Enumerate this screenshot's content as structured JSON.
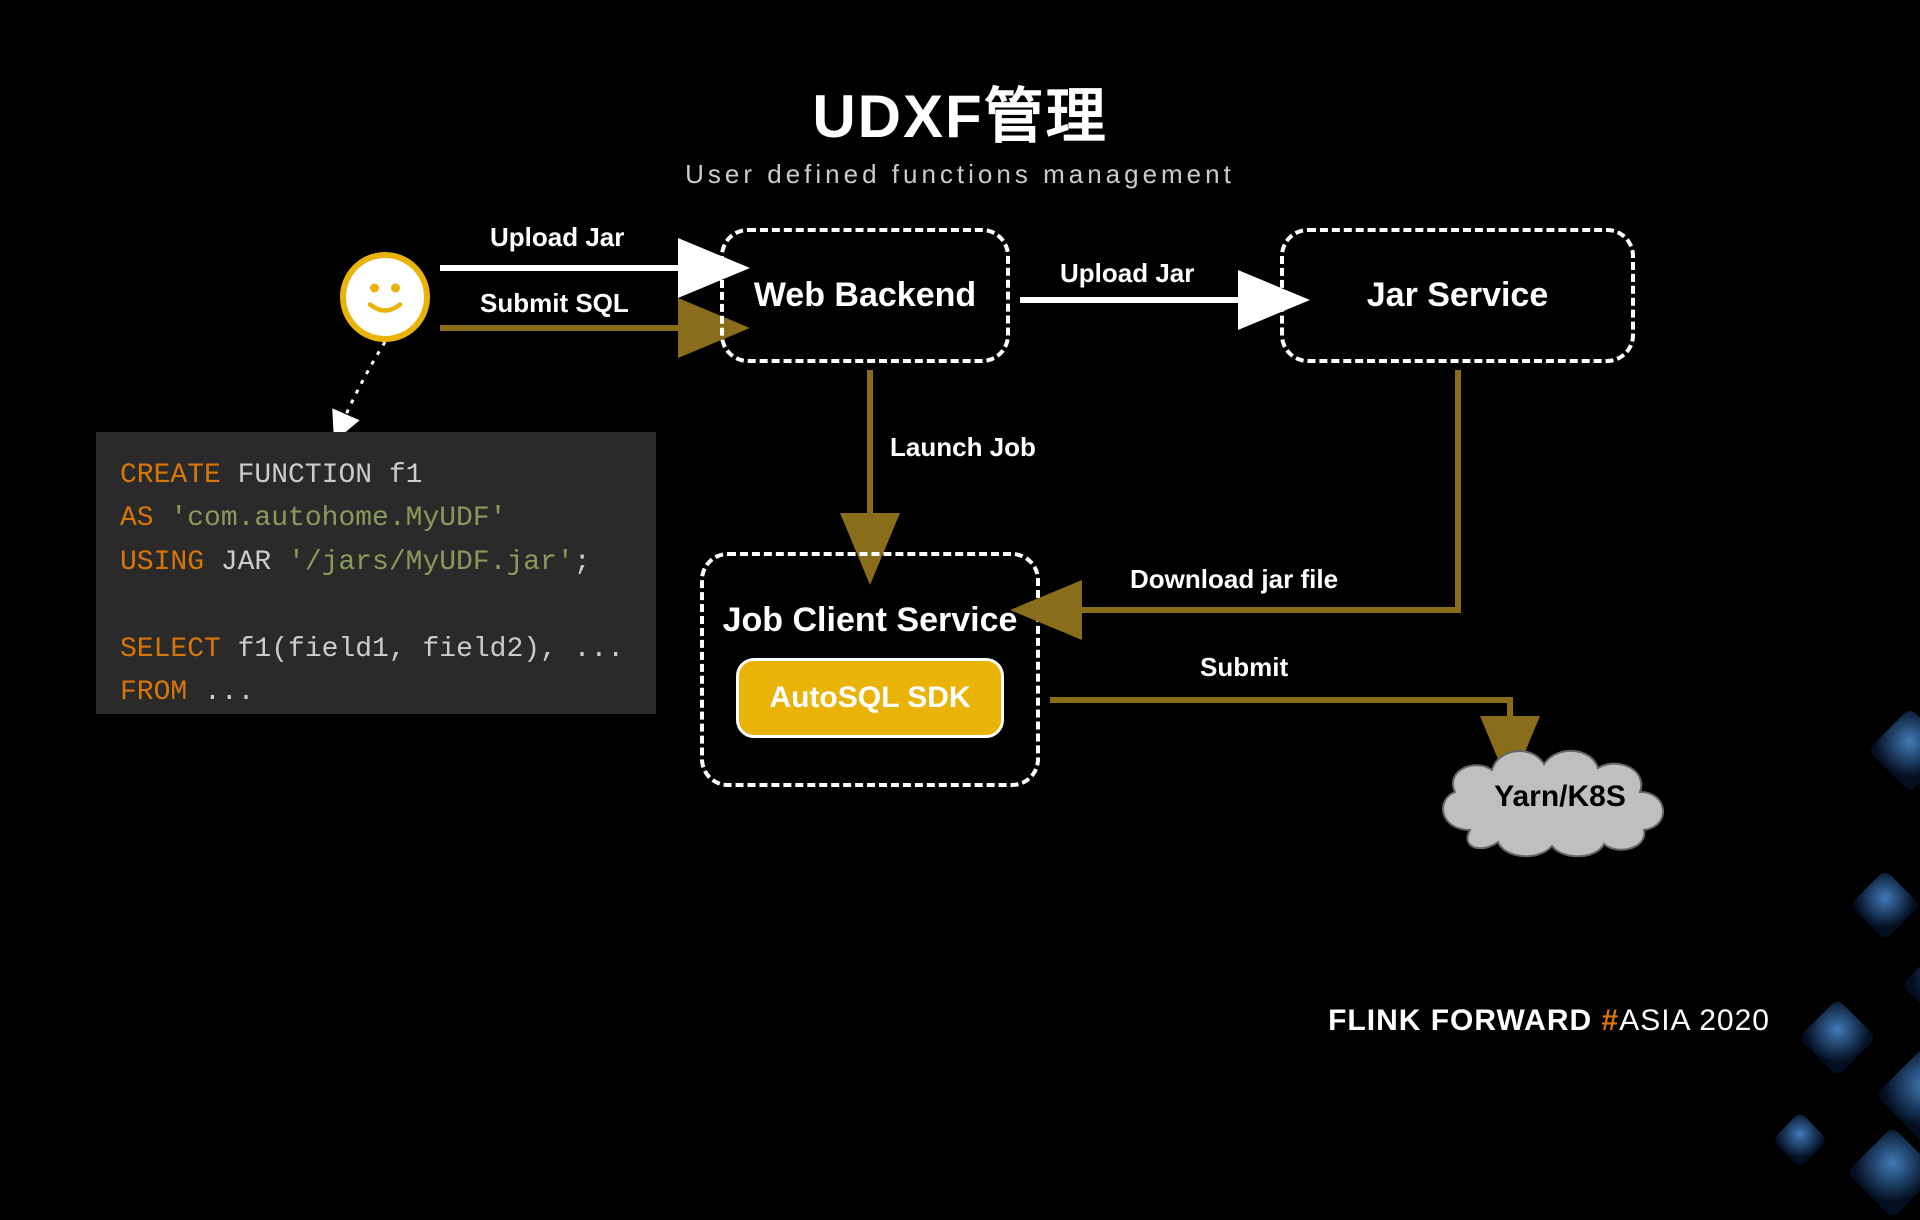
{
  "title": "UDXF管理",
  "subtitle": "User defined functions management",
  "boxes": {
    "web_backend": "Web Backend",
    "jar_service": "Jar Service",
    "job_client": "Job Client Service",
    "autosql": "AutoSQL SDK",
    "cloud": "Yarn/K8S"
  },
  "arrows": {
    "upload_jar_1": "Upload Jar",
    "submit_sql": "Submit SQL",
    "upload_jar_2": "Upload Jar",
    "launch_job": "Launch  Job",
    "download_jar": "Download jar file",
    "submit": "Submit"
  },
  "code": {
    "l1_a": "CREATE",
    "l1_b": " FUNCTION f1",
    "l2_a": "AS",
    "l2_b": " 'com.autohome.MyUDF'",
    "l3_a": "USING",
    "l3_b": " JAR ",
    "l3_c": "'/jars/MyUDF.jar'",
    "l3_d": ";",
    "l5_a": "SELECT",
    "l5_b": " f1(field1, field2), ...",
    "l6_a": "FROM",
    "l6_b": " ..."
  },
  "footer": {
    "flink": "FLINK ",
    "forward": "FORWARD ",
    "hash": "#",
    "asia": "ASIA 2020"
  }
}
